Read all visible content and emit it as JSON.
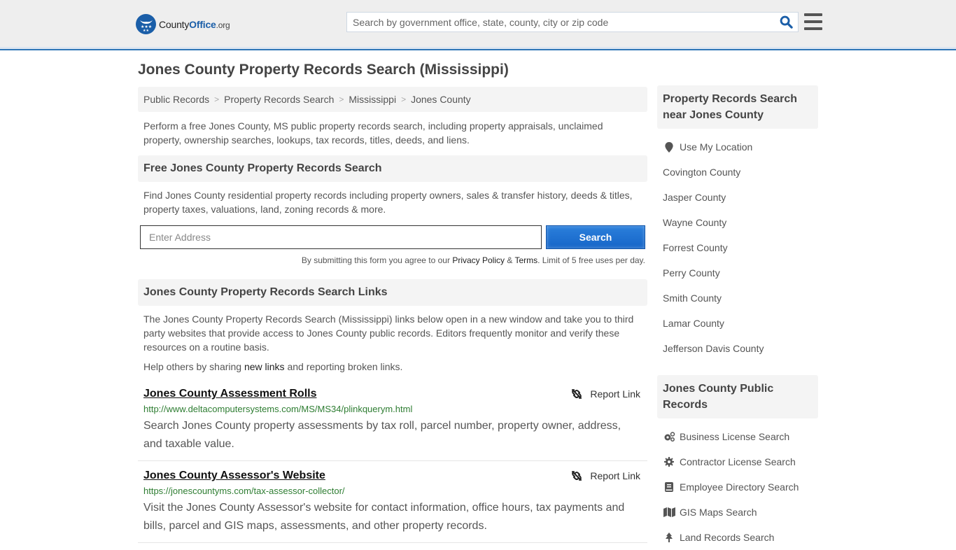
{
  "header": {
    "logo": {
      "part1": "County",
      "part2": "Office",
      "part3": ".org"
    },
    "search_placeholder": "Search by government office, state, county, city or zip code",
    "accent_color": "#2e75b6"
  },
  "page": {
    "title": "Jones County Property Records Search (Mississippi)"
  },
  "breadcrumb": [
    {
      "label": "Public Records"
    },
    {
      "label": "Property Records Search"
    },
    {
      "label": "Mississippi"
    },
    {
      "label": "Jones County"
    }
  ],
  "intro": "Perform a free Jones County, MS public property records search, including property appraisals, unclaimed property, ownership searches, lookups, tax records, titles, deeds, and liens.",
  "free_search": {
    "heading": "Free Jones County Property Records Search",
    "text": "Find Jones County residential property records including property owners, sales & transfer history, deeds & titles, property taxes, valuations, land, zoning records & more.",
    "address_placeholder": "Enter Address",
    "button_label": "Search",
    "disclaimer_pre": "By submitting this form you agree to our ",
    "privacy_label": "Privacy Policy",
    "amp": " & ",
    "terms_label": "Terms",
    "disclaimer_post": ". Limit of 5 free uses per day."
  },
  "links_section": {
    "heading": "Jones County Property Records Search Links",
    "text": "The Jones County Property Records Search (Mississippi) links below open in a new window and take you to third party websites that provide access to Jones County public records. Editors frequently monitor and verify these resources on a routine basis.",
    "help_pre": "Help others by sharing ",
    "help_link": "new links",
    "help_post": " and reporting broken links.",
    "report_label": "Report Link",
    "items": [
      {
        "title": "Jones County Assessment Rolls",
        "url": "http://www.deltacomputersystems.com/MS/MS34/plinkquerym.html",
        "description": "Search Jones County property assessments by tax roll, parcel number, property owner, address, and taxable value."
      },
      {
        "title": "Jones County Assessor's Website",
        "url": "https://jonescountyms.com/tax-assessor-collector/",
        "description": "Visit the Jones County Assessor's website for contact information, office hours, tax payments and bills, parcel and GIS maps, assessments, and other property records."
      }
    ]
  },
  "sidebar": {
    "nearby_heading": "Property Records Search near Jones County",
    "use_location": "Use My Location",
    "nearby": [
      "Covington County",
      "Jasper County",
      "Wayne County",
      "Forrest County",
      "Perry County",
      "Smith County",
      "Lamar County",
      "Jefferson Davis County"
    ],
    "public_heading": "Jones County Public Records",
    "public_records": [
      {
        "label": "Business License Search",
        "icon": "cogs-icon"
      },
      {
        "label": "Contractor License Search",
        "icon": "gear-icon"
      },
      {
        "label": "Employee Directory Search",
        "icon": "book-icon"
      },
      {
        "label": "GIS Maps Search",
        "icon": "map-icon"
      },
      {
        "label": "Land Records Search",
        "icon": "tree-icon"
      }
    ]
  }
}
